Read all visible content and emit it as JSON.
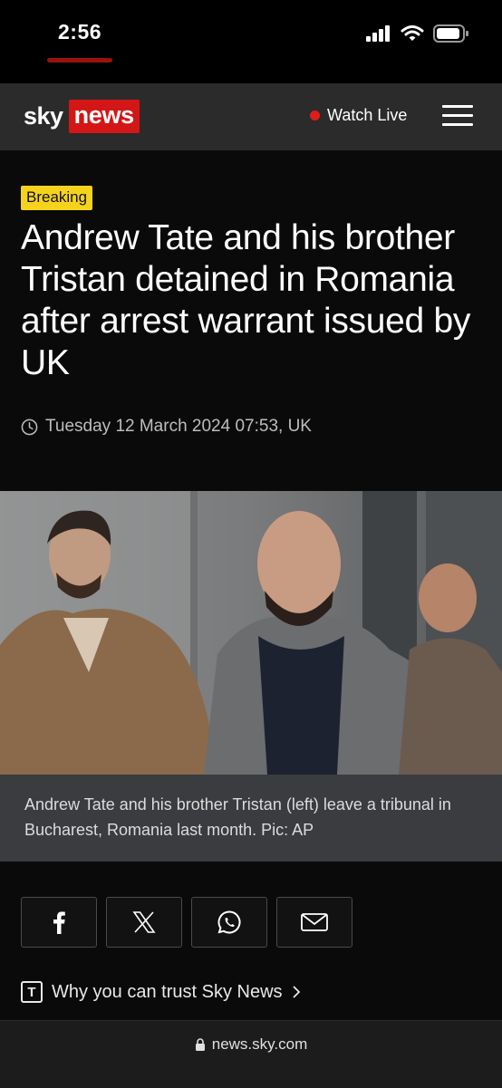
{
  "status_bar": {
    "time": "2:56"
  },
  "header": {
    "logo_sky": "sky",
    "logo_news": "news",
    "watch_live_label": "Watch Live",
    "brand_red": "#d31616"
  },
  "article": {
    "badge": "Breaking",
    "badge_color": "#f5d31d",
    "headline": "Andrew Tate and his brother Tristan detained in Romania after arrest warrant issued by UK",
    "date": "Tuesday 12 March 2024 07:53, UK",
    "caption": "Andrew Tate and his brother Tristan (left) leave a tribunal in Bucharest, Romania last month. Pic: AP"
  },
  "share_buttons": [
    {
      "icon": "facebook-icon"
    },
    {
      "icon": "x-icon"
    },
    {
      "icon": "whatsapp-icon"
    },
    {
      "icon": "email-icon"
    }
  ],
  "trust_link": {
    "label": "Why you can trust Sky News"
  },
  "browser": {
    "url": "news.sky.com"
  }
}
